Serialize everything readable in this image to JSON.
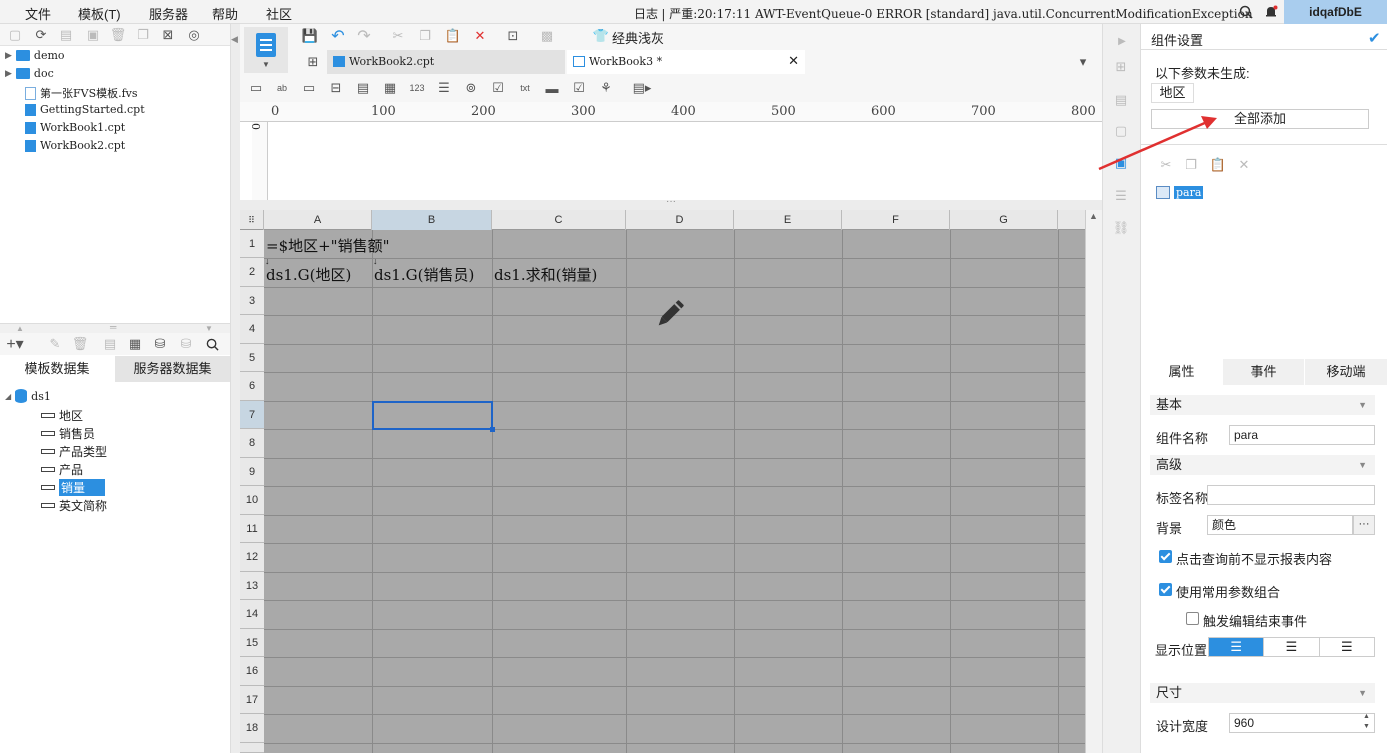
{
  "menubar": {
    "items": [
      "文件",
      "模板(T)",
      "服务器",
      "帮助",
      "社区"
    ],
    "log_label": "日志",
    "log_message": "| 严重:20:17:11 AWT-EventQueue-0 ERROR [standard] java.util.ConcurrentModificationException",
    "user": "idqafDbE"
  },
  "filetree": {
    "items": [
      {
        "label": "demo",
        "type": "folder"
      },
      {
        "label": "doc",
        "type": "folder"
      },
      {
        "label": "第一张FVS模板.fvs",
        "type": "fvs"
      },
      {
        "label": "GettingStarted.cpt",
        "type": "cpt"
      },
      {
        "label": "WorkBook1.cpt",
        "type": "cpt"
      },
      {
        "label": "WorkBook2.cpt",
        "type": "cpt"
      }
    ]
  },
  "datasets": {
    "tabs": [
      "模板数据集",
      "服务器数据集"
    ],
    "root": "ds1",
    "fields": [
      "地区",
      "销售员",
      "产品类型",
      "产品",
      "销量",
      "英文简称"
    ],
    "selected_field": "销量"
  },
  "editor": {
    "theme_label": "经典浅灰",
    "tabs": [
      {
        "label": "WorkBook2.cpt",
        "active": false
      },
      {
        "label": "WorkBook3 *",
        "active": true
      }
    ],
    "ruler_labels": [
      "0",
      "100",
      "200",
      "300",
      "400",
      "500",
      "600",
      "700",
      "800"
    ],
    "vruler_label": "0",
    "columns": [
      "A",
      "B",
      "C",
      "D",
      "E",
      "F",
      "G"
    ],
    "rows": [
      "1",
      "2",
      "3",
      "4",
      "5",
      "6",
      "7",
      "8",
      "9",
      "10",
      "11",
      "12",
      "13",
      "14",
      "15",
      "16",
      "17",
      "18"
    ],
    "cells": {
      "A1": "=$地区+\"销售额\"",
      "A2": "ds1.G(地区)",
      "B2": "ds1.G(销售员)",
      "C2": "ds1.求和(销量)"
    },
    "selected_cell": "B7"
  },
  "right_panel": {
    "title": "组件设置",
    "unbuilt_label": "以下参数未生成:",
    "param_chip": "地区",
    "add_all": "全部添加",
    "widget_tree_item": "para",
    "tabs": [
      "属性",
      "事件",
      "移动端"
    ],
    "sections": {
      "basic": "基本",
      "advanced": "高级",
      "size": "尺寸"
    },
    "widget_name_label": "组件名称",
    "widget_name_value": "para",
    "tag_name_label": "标签名称",
    "tag_name_value": "",
    "background_label": "背景",
    "background_value": "颜色",
    "check1": "点击查询前不显示报表内容",
    "check2": "使用常用参数组合",
    "check3": "触发编辑结束事件",
    "position_label": "显示位置",
    "width_label": "设计宽度",
    "width_value": "960"
  },
  "colors": {
    "accent": "#2c8fe0",
    "grid_bg": "#a9a9a9",
    "annotation_arrow": "#e03030"
  }
}
